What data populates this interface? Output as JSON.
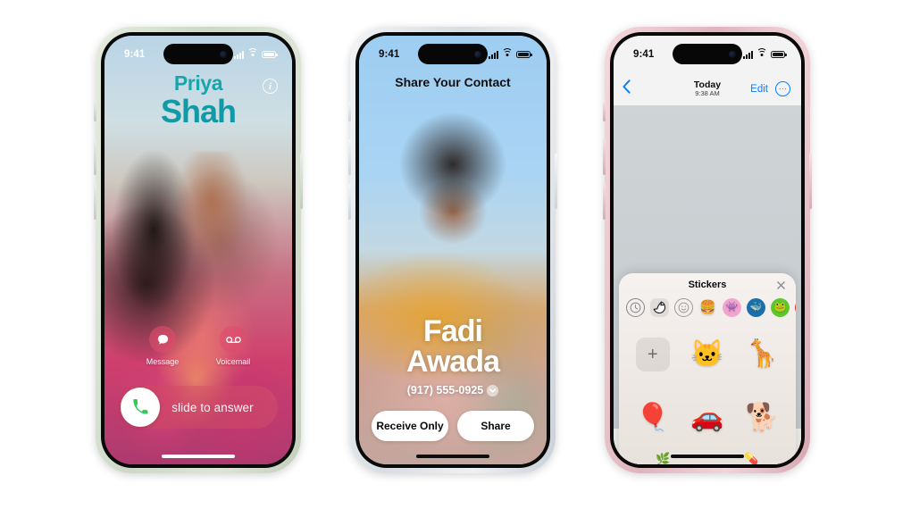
{
  "scene": {
    "description": "Three iPhone 15 devices side by side showing iOS 17 features",
    "background": "#ffffff"
  },
  "phones": [
    {
      "id": "phone-call",
      "frame_color": "#cdd8c6",
      "frame_name": "green-titanium",
      "status": {
        "time": "9:41",
        "cellular": "cellular-icon",
        "wifi": "wifi-icon",
        "battery": "battery-icon"
      },
      "screen": {
        "name": "incoming-call",
        "contact_first_name": "Priya",
        "contact_last_name": "Shah",
        "name_color": "#0f9aa6",
        "info_glyph": "i",
        "actions": [
          {
            "icon": "message-bubble-icon",
            "label": "Message"
          },
          {
            "icon": "voicemail-icon",
            "label": "Voicemail"
          }
        ],
        "slider": {
          "label": "slide to answer",
          "knob_icon": "phone-handset-icon",
          "knob_color": "#34c759"
        }
      }
    },
    {
      "id": "phone-share",
      "frame_color": "#d7dde2",
      "frame_name": "white-titanium",
      "status": {
        "time": "9:41",
        "cellular": "cellular-icon",
        "wifi": "wifi-icon",
        "battery": "battery-icon"
      },
      "screen": {
        "name": "name-drop-share-contact",
        "title": "Share Your Contact",
        "contact_first_name": "Fadi",
        "contact_last_name": "Awada",
        "phone_number": "(917) 555-0925",
        "phone_chevron": "chevron-down-icon",
        "buttons": [
          {
            "label": "Receive Only",
            "name": "receive-only-button"
          },
          {
            "label": "Share",
            "name": "share-button"
          }
        ]
      }
    },
    {
      "id": "phone-msgs",
      "frame_color": "#e0b3bd",
      "frame_name": "pink-aluminum",
      "status": {
        "time": "9:41",
        "cellular": "cellular-icon",
        "wifi": "wifi-icon",
        "battery": "battery-icon"
      },
      "screen": {
        "name": "messages-stickers",
        "nav": {
          "back_icon": "chevron-left-icon",
          "title_day": "Today",
          "title_time": "9:38 AM",
          "edit_label": "Edit",
          "more_icon": "ellipsis-circle-icon",
          "accent_color": "#0a7cff"
        },
        "photo": {
          "name": "cat-on-leather-ottoman-photo"
        },
        "stickers_panel": {
          "title": "Stickers",
          "close_icon": "close-x-icon",
          "categories": [
            {
              "name": "recents-clock-icon",
              "glyph": "◴",
              "selected": false
            },
            {
              "name": "live-sticker-icon",
              "glyph": "",
              "selected": true
            },
            {
              "name": "emoji-smiley-icon",
              "glyph": "☺",
              "selected": false
            },
            {
              "name": "sticker-pack-food-icon",
              "glyph": "🍔",
              "selected": false
            },
            {
              "name": "sticker-pack-pink-icon",
              "glyph": "👾",
              "selected": false
            },
            {
              "name": "sticker-pack-blue-icon",
              "glyph": "🐳",
              "selected": false
            },
            {
              "name": "sticker-pack-green-icon",
              "glyph": "🐸",
              "selected": false
            },
            {
              "name": "sticker-pack-red-icon",
              "glyph": "🍎",
              "selected": false
            }
          ],
          "tiles": [
            {
              "name": "add-sticker-button",
              "glyph": "+",
              "type": "add"
            },
            {
              "name": "cat-sticker",
              "glyph": "🐱",
              "type": "sticker"
            },
            {
              "name": "giraffe-sticker",
              "glyph": "🦒",
              "type": "sticker"
            },
            {
              "name": "hot-air-balloon-sticker",
              "glyph": "🎈",
              "type": "sticker"
            },
            {
              "name": "red-car-sticker",
              "glyph": "🚗",
              "type": "sticker"
            },
            {
              "name": "dog-in-hat-sticker",
              "glyph": "🐕",
              "type": "sticker"
            }
          ]
        }
      }
    }
  ]
}
